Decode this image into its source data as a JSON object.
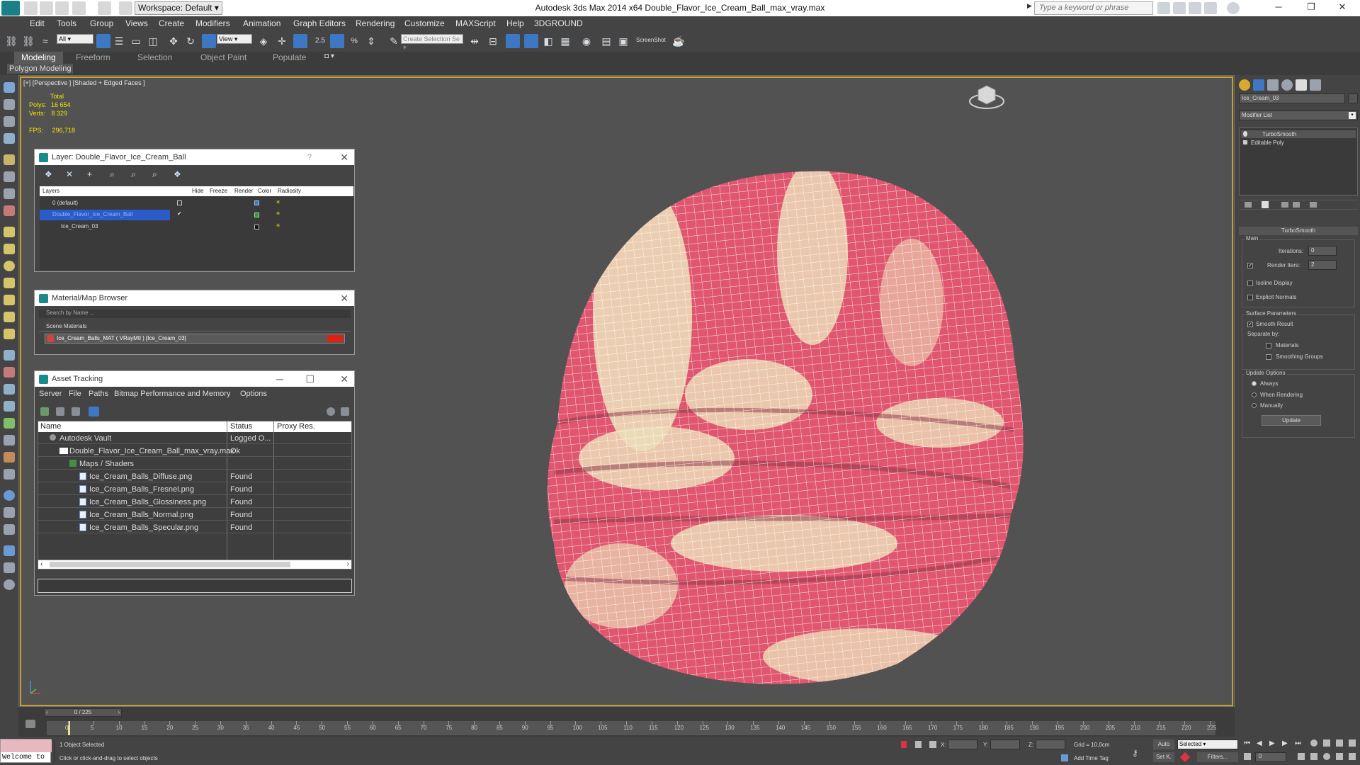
{
  "app": {
    "workspace": "Workspace: Default",
    "title": "Autodesk 3ds Max  2014 x64     Double_Flavor_Ice_Cream_Ball_max_vray.max",
    "search_placeholder": "Type a keyword or phrase"
  },
  "menu": [
    "Edit",
    "Tools",
    "Group",
    "Views",
    "Create",
    "Modifiers",
    "Animation",
    "Graph Editors",
    "Rendering",
    "Customize",
    "MAXScript",
    "Help",
    "3DGROUND"
  ],
  "toolbar": {
    "filter_value": "All",
    "view_value": "View",
    "selection_set_placeholder": "Create Selection Se",
    "screenshot_label": "ScreenShot",
    "snap_label": "2.5",
    "angle_snap_label": "%"
  },
  "ribbon": {
    "tabs": [
      "Modeling",
      "Freeform",
      "Selection",
      "Object Paint",
      "Populate"
    ],
    "active_tab": "Modeling",
    "subpanel": "Polygon Modeling"
  },
  "viewport": {
    "label": "[+] [Perspective ] [Shaded + Edged Faces ]",
    "stats_header": "Total",
    "polys_label": "Polys:",
    "polys_value": "16 654",
    "verts_label": "Verts:",
    "verts_value": "8 329",
    "fps_label": "FPS:",
    "fps_value": "296,718",
    "colors": {
      "pink": "#e0566f",
      "cream": "#ecdcb8",
      "wire": "#ffffff",
      "border": "#c9a12a"
    }
  },
  "layer_dialog": {
    "title": "Layer: Double_Flavor_Ice_Cream_Ball",
    "help": "?",
    "columns": [
      "Layers",
      "Hide",
      "Freeze",
      "Render",
      "Color",
      "Radiosity"
    ],
    "rows": [
      {
        "name": "0 (default)",
        "color": "#3a7bd5"
      },
      {
        "name": "Double_Flavor_Ice_Cream_Ball",
        "color": "#2aa02a"
      },
      {
        "name": "Ice_Cream_03",
        "color": "#111111"
      }
    ]
  },
  "material_browser": {
    "title": "Material/Map Browser",
    "search_placeholder": "Search by Name ...",
    "section": "Scene Materials",
    "item": "Ice_Cream_Balls_MAT  ( VRayMtl ) [Ice_Cream_03]"
  },
  "asset_tracking": {
    "title": "Asset Tracking",
    "menu": [
      "Server",
      "File",
      "Paths",
      "Bitmap Performance and Memory",
      "Options"
    ],
    "columns": [
      "Name",
      "Status",
      "Proxy Res."
    ],
    "rows": [
      {
        "name": "Autodesk Vault",
        "status": "Logged O..."
      },
      {
        "name": "Double_Flavor_Ice_Cream_Ball_max_vray.max",
        "status": "Ok"
      },
      {
        "name": "Maps / Shaders",
        "status": ""
      },
      {
        "name": "Ice_Cream_Balls_Diffuse.png",
        "status": "Found"
      },
      {
        "name": "Ice_Cream_Balls_Fresnel.png",
        "status": "Found"
      },
      {
        "name": "Ice_Cream_Balls_Glossiness.png",
        "status": "Found"
      },
      {
        "name": "Ice_Cream_Balls_Normal.png",
        "status": "Found"
      },
      {
        "name": "Ice_Cream_Balls_Specular.png",
        "status": "Found"
      }
    ]
  },
  "command_panel": {
    "object_name": "Ice_Cream_03",
    "modifier_list": "Modifier List",
    "stack": [
      "TurboSmooth",
      "Editable Poly"
    ],
    "rollout_title": "TurboSmooth",
    "main_group": "Main",
    "iterations_label": "Iterations:",
    "iterations_value": "0",
    "render_iters_label": "Render Iters:",
    "render_iters_value": "2",
    "isoline": "Isoline Display",
    "explicit_normals": "Explicit Normals",
    "surface_group": "Surface Parameters",
    "smooth_result": "Smooth Result",
    "separate_by": "Separate by:",
    "materials": "Materials",
    "smoothing_groups": "Smoothing Groups",
    "update_group": "Update Options",
    "always": "Always",
    "when_rendering": "When Rendering",
    "manually": "Manually",
    "update_button": "Update"
  },
  "timeline": {
    "frame_counter": "0 / 225",
    "ticks": [
      0,
      5,
      10,
      15,
      20,
      25,
      30,
      35,
      40,
      45,
      50,
      55,
      60,
      65,
      70,
      75,
      80,
      85,
      90,
      95,
      100,
      105,
      110,
      115,
      120,
      125,
      130,
      135,
      140,
      145,
      150,
      155,
      160,
      165,
      170,
      175,
      180,
      185,
      190,
      195,
      200,
      205,
      210,
      215,
      220,
      225
    ]
  },
  "status": {
    "welcome": "Welcome to",
    "selected": "1 Object Selected",
    "hint": "Click or click-and-drag to select objects",
    "x_label": "X:",
    "y_label": "Y:",
    "z_label": "Z:",
    "grid": "Grid = 10,0cm",
    "add_time_tag": "Add Time Tag",
    "auto": "Auto",
    "set_k": "Set K.",
    "selected_dropdown": "Selected",
    "filters": "Filters...",
    "frame": "0"
  }
}
